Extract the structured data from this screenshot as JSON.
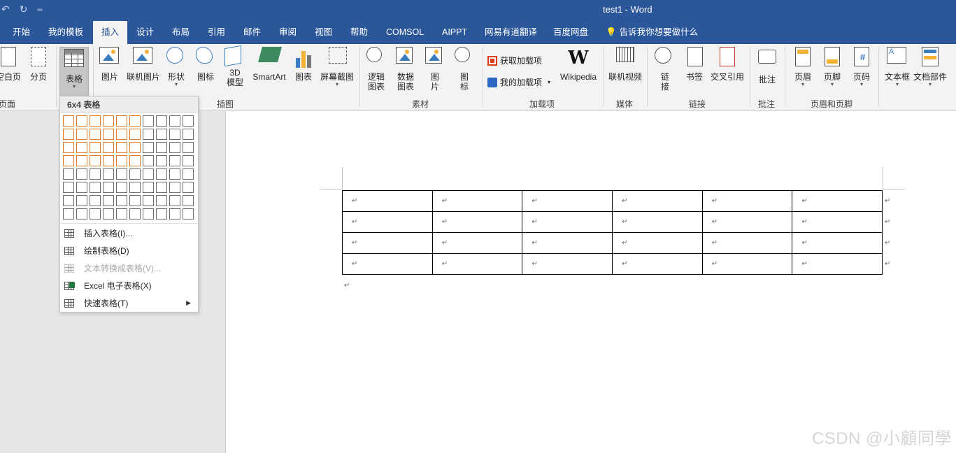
{
  "titlebar": {
    "title": "test1  -  Word",
    "qat": [
      "undo-icon",
      "redo-icon",
      "customize-icon"
    ]
  },
  "tabs": [
    {
      "label": "开始"
    },
    {
      "label": "我的模板"
    },
    {
      "label": "插入",
      "active": true
    },
    {
      "label": "设计"
    },
    {
      "label": "布局"
    },
    {
      "label": "引用"
    },
    {
      "label": "邮件"
    },
    {
      "label": "审阅"
    },
    {
      "label": "视图"
    },
    {
      "label": "帮助"
    },
    {
      "label": "COMSOL"
    },
    {
      "label": "AIPPT"
    },
    {
      "label": "网易有道翻译"
    },
    {
      "label": "百度网盘"
    }
  ],
  "tell_me": "告诉我你想要做什么",
  "ribbon": {
    "pages": {
      "blank_page": "空白页",
      "page_break": "分页",
      "group": "页面"
    },
    "tables": {
      "table": "表格"
    },
    "illustrations": {
      "picture": "图片",
      "online_picture": "联机图片",
      "shapes": "形状",
      "icons": "图标",
      "model3d_1": "3D",
      "model3d_2": "模型",
      "smartart": "SmartArt",
      "chart": "图表",
      "screenshot": "屏幕截图",
      "group": "插图"
    },
    "materials": {
      "logic_chart_1": "逻辑",
      "logic_chart_2": "图表",
      "data_chart_1": "数据",
      "data_chart_2": "图表",
      "pic_1": "图",
      "pic_2": "片",
      "icon_1": "图",
      "icon_2": "标",
      "group": "素材"
    },
    "addins": {
      "get_addins": "获取加载项",
      "my_addins": "我的加载项",
      "wikipedia": "Wikipedia",
      "group": "加载项"
    },
    "media": {
      "online_video": "联机视频",
      "group": "媒体"
    },
    "links": {
      "link_1": "链",
      "link_2": "接",
      "bookmark": "书签",
      "cross_ref": "交叉引用",
      "group": "链接"
    },
    "comments": {
      "comment": "批注",
      "group": "批注"
    },
    "header_footer": {
      "header": "页眉",
      "footer": "页脚",
      "page_number": "页码",
      "group": "页眉和页脚"
    },
    "text": {
      "textbox": "文本框",
      "quick_parts": "文档部件"
    }
  },
  "table_menu": {
    "title": "6x4 表格",
    "grid_cols": 10,
    "grid_rows": 8,
    "selected_cols": 6,
    "selected_rows": 4,
    "items": [
      {
        "label": "插入表格(I)...",
        "enabled": true
      },
      {
        "label": "绘制表格(D)",
        "enabled": true
      },
      {
        "label": "文本转换成表格(V)...",
        "enabled": false
      },
      {
        "label": "Excel 电子表格(X)",
        "enabled": true
      },
      {
        "label": "快速表格(T)",
        "enabled": true,
        "submenu": true
      }
    ]
  },
  "document": {
    "table_rows": 4,
    "table_cols": 6,
    "cell_mark": "↵",
    "para_mark": "↵"
  },
  "watermark": "CSDN @小顧同學"
}
